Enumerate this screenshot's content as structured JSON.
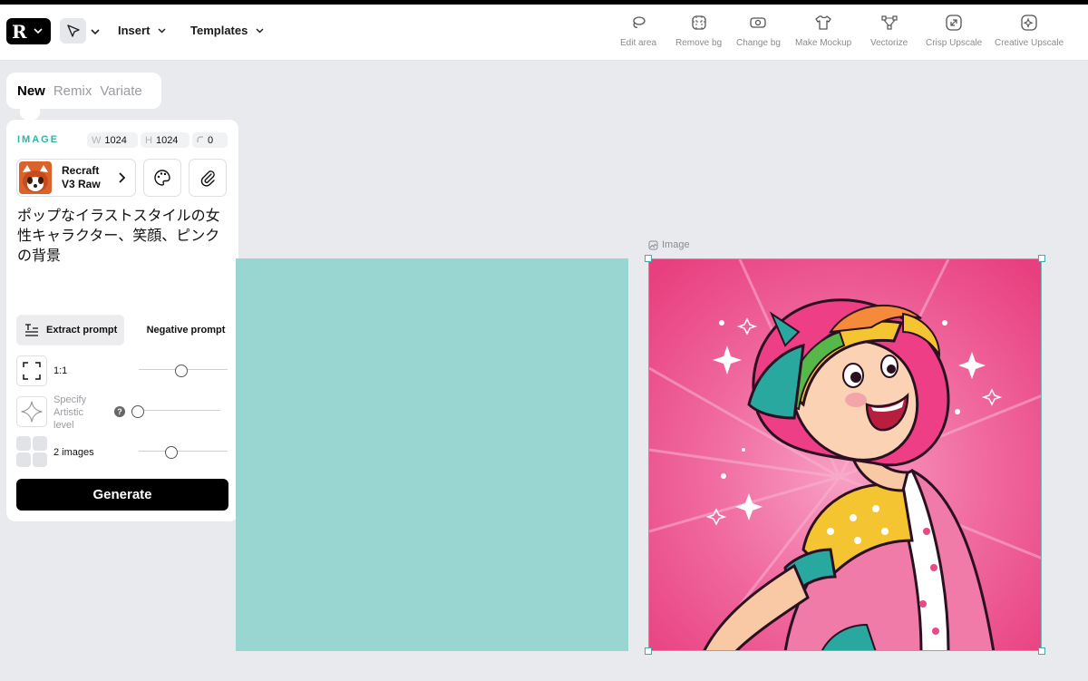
{
  "toolbar": {
    "logo": "R",
    "insert_label": "Insert",
    "templates_label": "Templates",
    "actions": [
      {
        "label": "Edit area",
        "icon": "lasso-icon"
      },
      {
        "label": "Remove bg",
        "icon": "remove-bg-icon"
      },
      {
        "label": "Change bg",
        "icon": "change-bg-icon"
      },
      {
        "label": "Make Mockup",
        "icon": "tshirt-icon"
      },
      {
        "label": "Vectorize",
        "icon": "vectorize-icon"
      },
      {
        "label": "Crisp Upscale",
        "icon": "upscale-icon"
      },
      {
        "label": "Creative Upscale",
        "icon": "creative-upscale-icon"
      }
    ]
  },
  "tabs": {
    "items": [
      "New",
      "Remix",
      "Variate"
    ],
    "active": "New"
  },
  "panel": {
    "section_label": "IMAGE",
    "width_key": "W",
    "width": "1024",
    "height_key": "H",
    "height": "1024",
    "radius_value": "0",
    "model_name": "Recraft V3 Raw",
    "prompt": "ポップなイラストスタイルの女性キャラクター、笑顔、ピンクの背景",
    "extract_prompt_label": "Extract prompt",
    "negative_prompt_label": "Negative prompt",
    "aspect_ratio_label": "1:1",
    "artistic_level_label": "Specify Artistic level",
    "help_glyph": "?",
    "images_count_label": "2 images",
    "generate_label": "Generate",
    "aspect_ratio_level": 0.48,
    "artistic_level": 0.0,
    "images_count_level": 0.35
  },
  "canvas": {
    "frame_label": "Image",
    "colors": {
      "teal_block": "#9ad6d1",
      "art_background": "#ee4c8a",
      "accent": "#2cb5a6"
    }
  }
}
